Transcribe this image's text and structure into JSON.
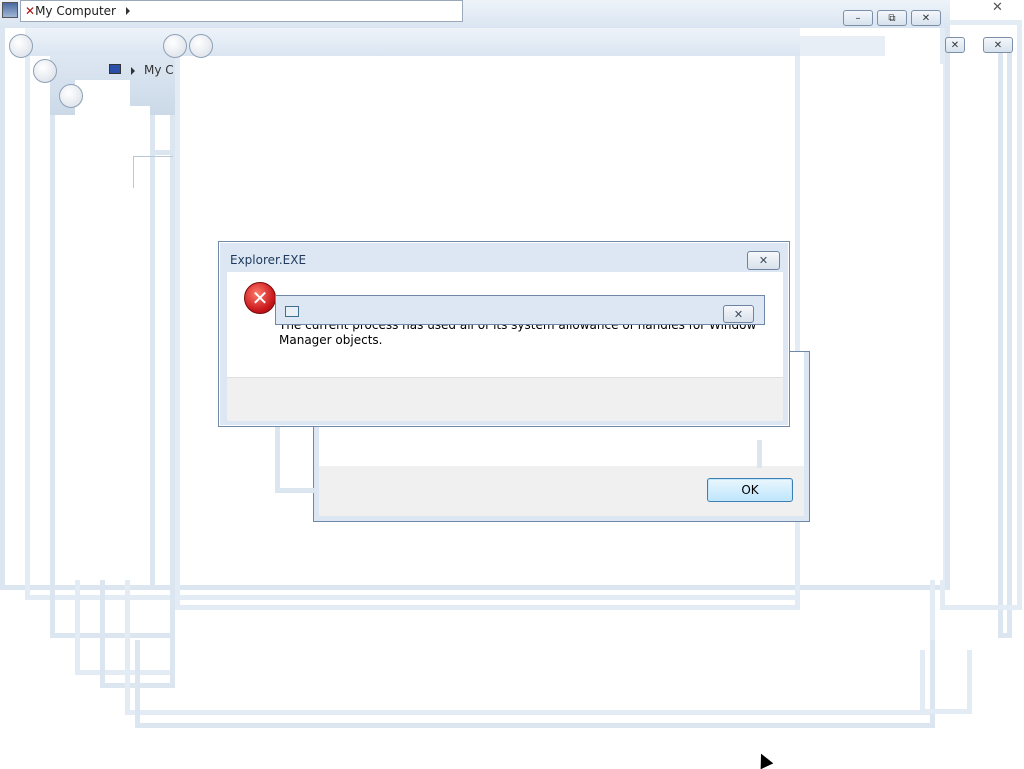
{
  "address_bar": {
    "location": "My Computer"
  },
  "sidebar_fragment": {
    "label": "My Co"
  },
  "window_controls": {
    "minimize": "–",
    "restore": "⧉",
    "close": "✕"
  },
  "error_dialog": {
    "title": "Explorer.EXE",
    "close_symbol": "✕",
    "icon_glyph": "✕",
    "message": "The current process has used all of its system allowance of handles for Window Manager objects.",
    "ok_label": "OK"
  },
  "colors": {
    "frame": "#dce6f1",
    "dialog_border": "#6f88a8",
    "error_red": "#c8161b",
    "ok_button": "#bee6fd"
  }
}
